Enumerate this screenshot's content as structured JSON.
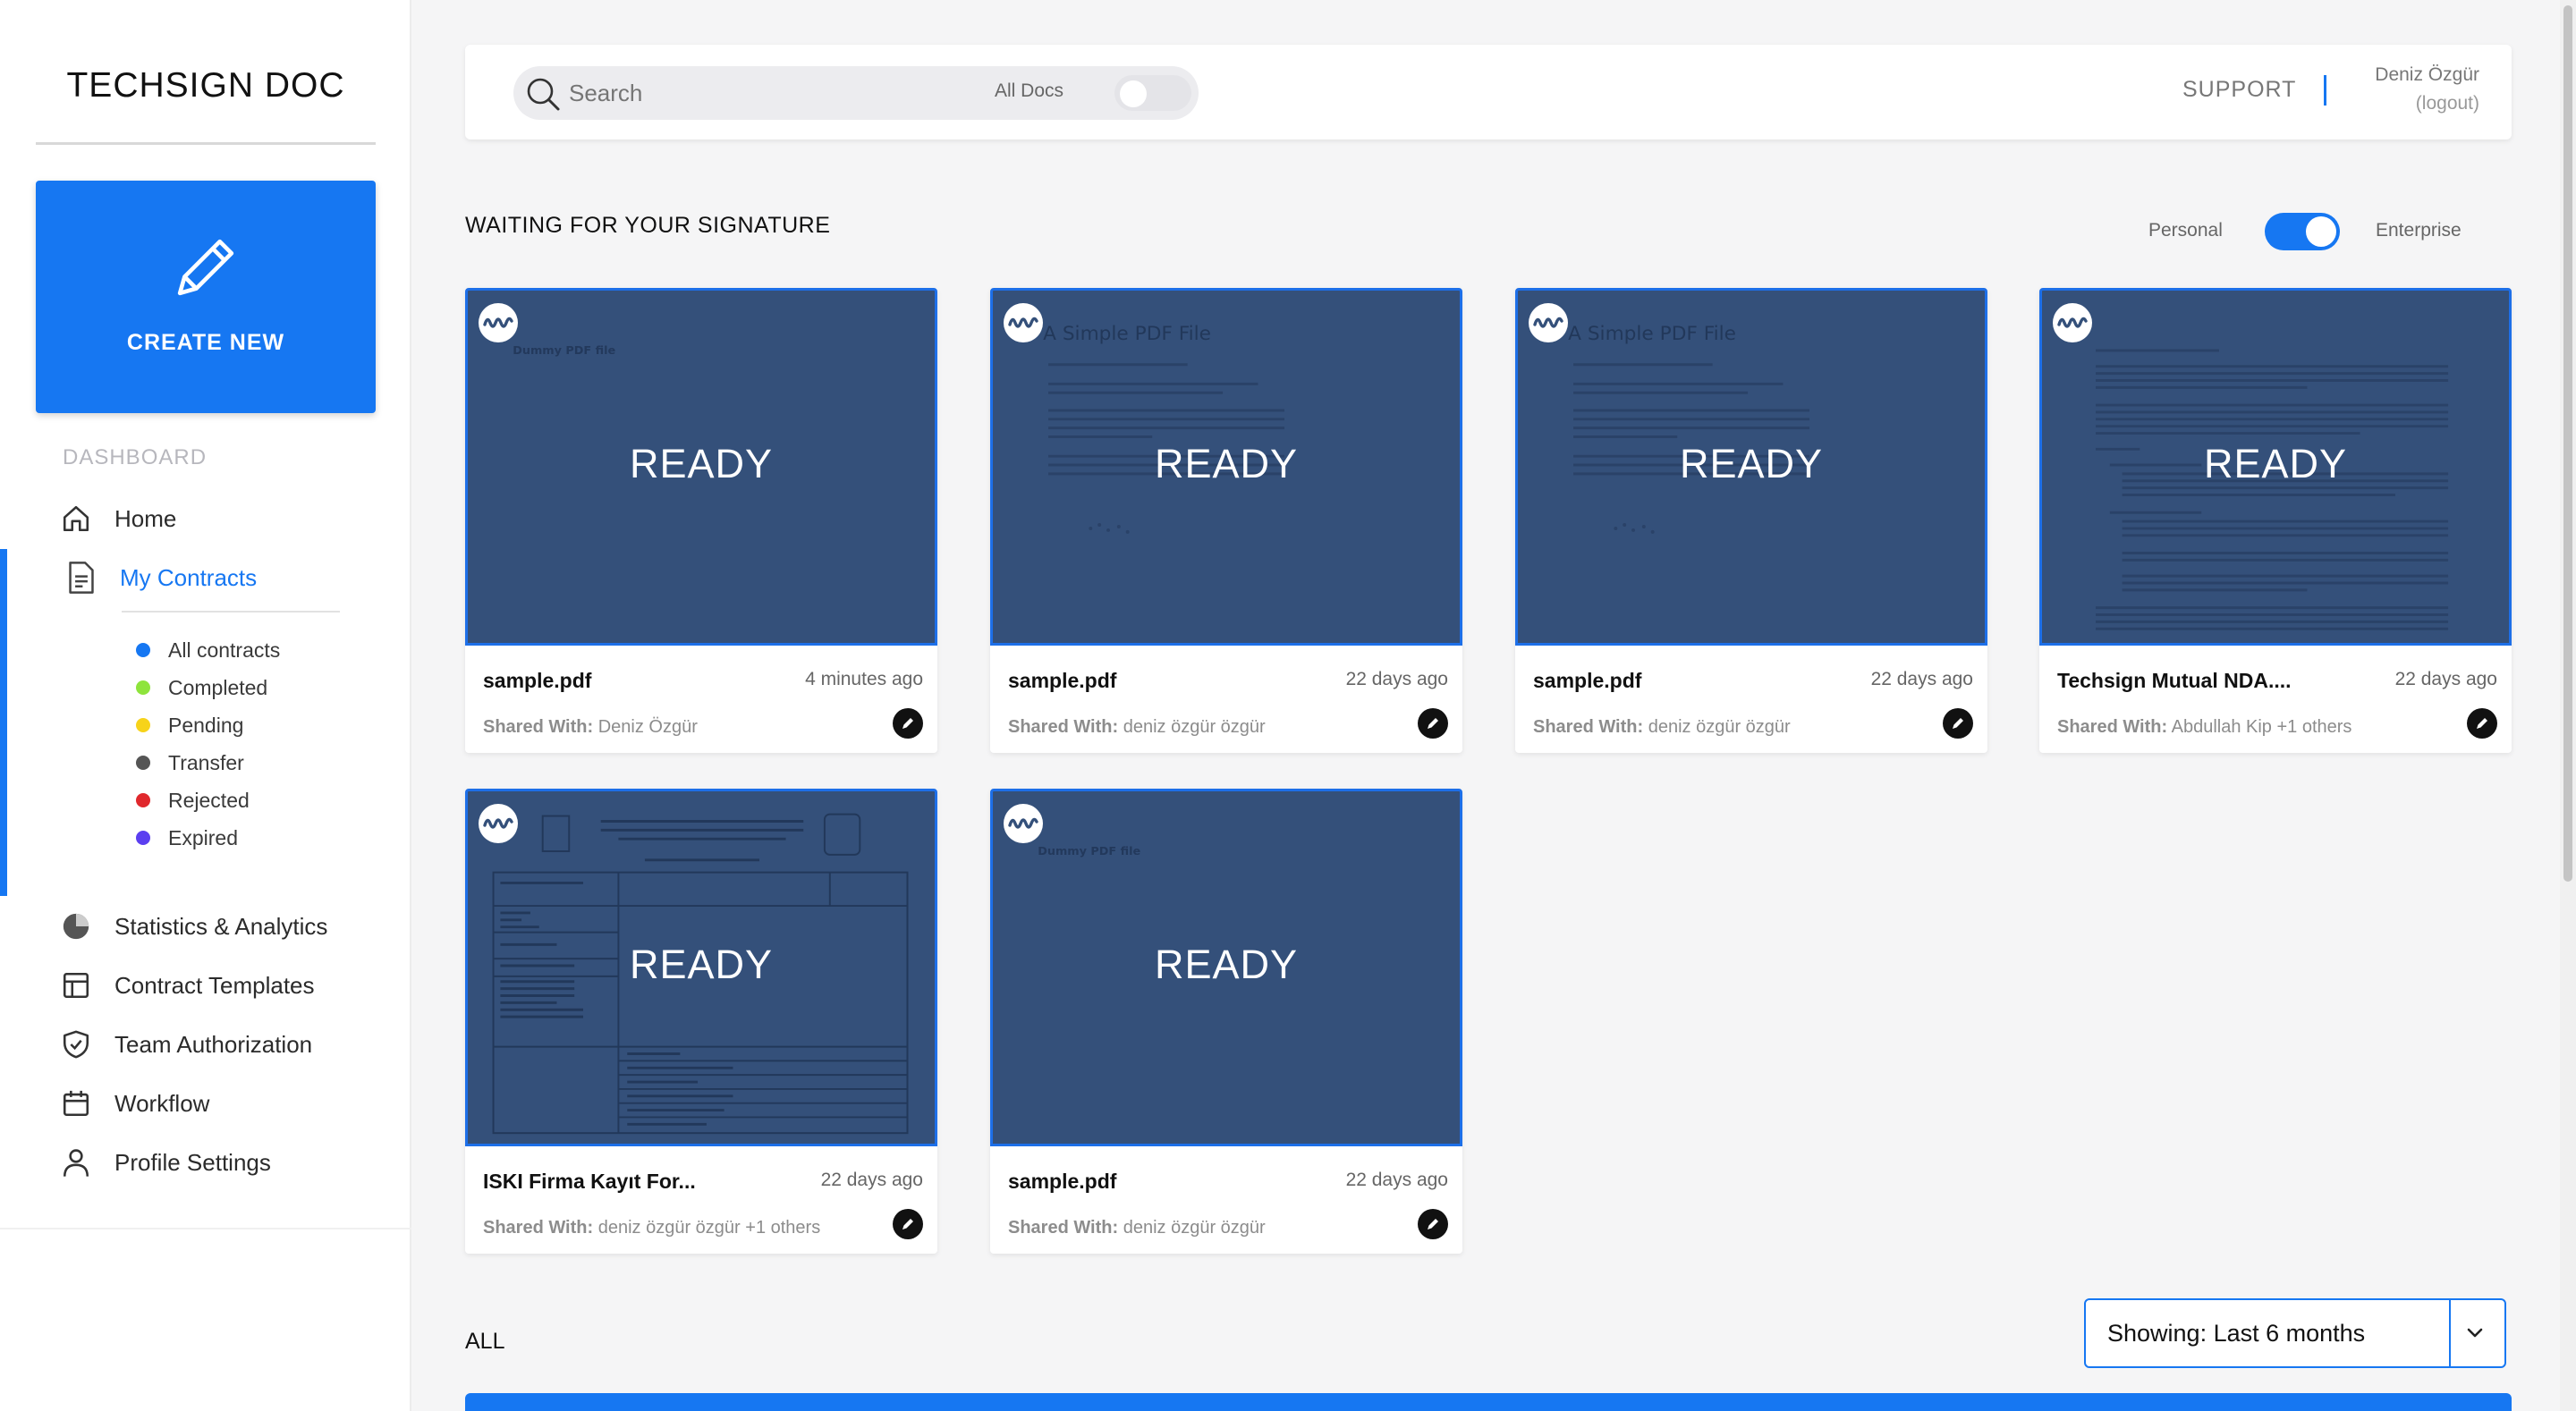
{
  "brand": {
    "bold": "TECHSIGN",
    "light": "DOC"
  },
  "sidebar": {
    "create_label": "CREATE NEW",
    "section_label": "DASHBOARD",
    "items": [
      {
        "label": "Home",
        "icon": "home-icon"
      },
      {
        "label": "My Contracts",
        "icon": "document-icon",
        "active": true
      },
      {
        "label": "Statistics & Analytics",
        "icon": "pie-chart-icon"
      },
      {
        "label": "Contract Templates",
        "icon": "template-icon"
      },
      {
        "label": "Team Authorization",
        "icon": "shield-check-icon"
      },
      {
        "label": "Workflow",
        "icon": "calendar-icon"
      },
      {
        "label": "Profile Settings",
        "icon": "user-icon"
      }
    ],
    "sub_items": [
      {
        "label": "All contracts",
        "color": "#1677f2"
      },
      {
        "label": "Completed",
        "color": "#8ee43c"
      },
      {
        "label": "Pending",
        "color": "#f7d31a"
      },
      {
        "label": "Transfer",
        "color": "#555555"
      },
      {
        "label": "Rejected",
        "color": "#e0282d"
      },
      {
        "label": "Expired",
        "color": "#5b3ff0"
      }
    ]
  },
  "topbar": {
    "search_placeholder": "Search",
    "scope_label": "All Docs",
    "support_label": "SUPPORT",
    "user_name": "Deniz Özgür",
    "logout_label": "(logout)"
  },
  "waiting": {
    "title": "WAITING FOR YOUR SIGNATURE",
    "mode_personal": "Personal",
    "mode_enterprise": "Enterprise",
    "mode_enterprise_on": true,
    "shared_prefix": "Shared With:",
    "cards": [
      {
        "status": "READY",
        "name": "sample.pdf",
        "time": "4 minutes ago",
        "shared": "Deniz Özgür",
        "preview": "dummy"
      },
      {
        "status": "READY",
        "name": "sample.pdf",
        "time": "22 days ago",
        "shared": "deniz özgür özgür",
        "preview": "simple"
      },
      {
        "status": "READY",
        "name": "sample.pdf",
        "time": "22 days ago",
        "shared": "deniz özgür özgür",
        "preview": "simple"
      },
      {
        "status": "READY",
        "name": "Techsign Mutual NDA....",
        "time": "22 days ago",
        "shared": "Abdullah Kip +1 others",
        "preview": "nda"
      },
      {
        "status": "READY",
        "name": "ISKI Firma Kayıt For...",
        "time": "22 days ago",
        "shared": "deniz özgür özgür +1 others",
        "preview": "form"
      },
      {
        "status": "READY",
        "name": "sample.pdf",
        "time": "22 days ago",
        "shared": "deniz özgür özgür",
        "preview": "dummy"
      }
    ],
    "preview_text": {
      "dummy": "Dummy PDF file",
      "simple": "A Simple PDF File"
    }
  },
  "all": {
    "title": "ALL",
    "filter_label": "Showing: Last 6 months"
  }
}
